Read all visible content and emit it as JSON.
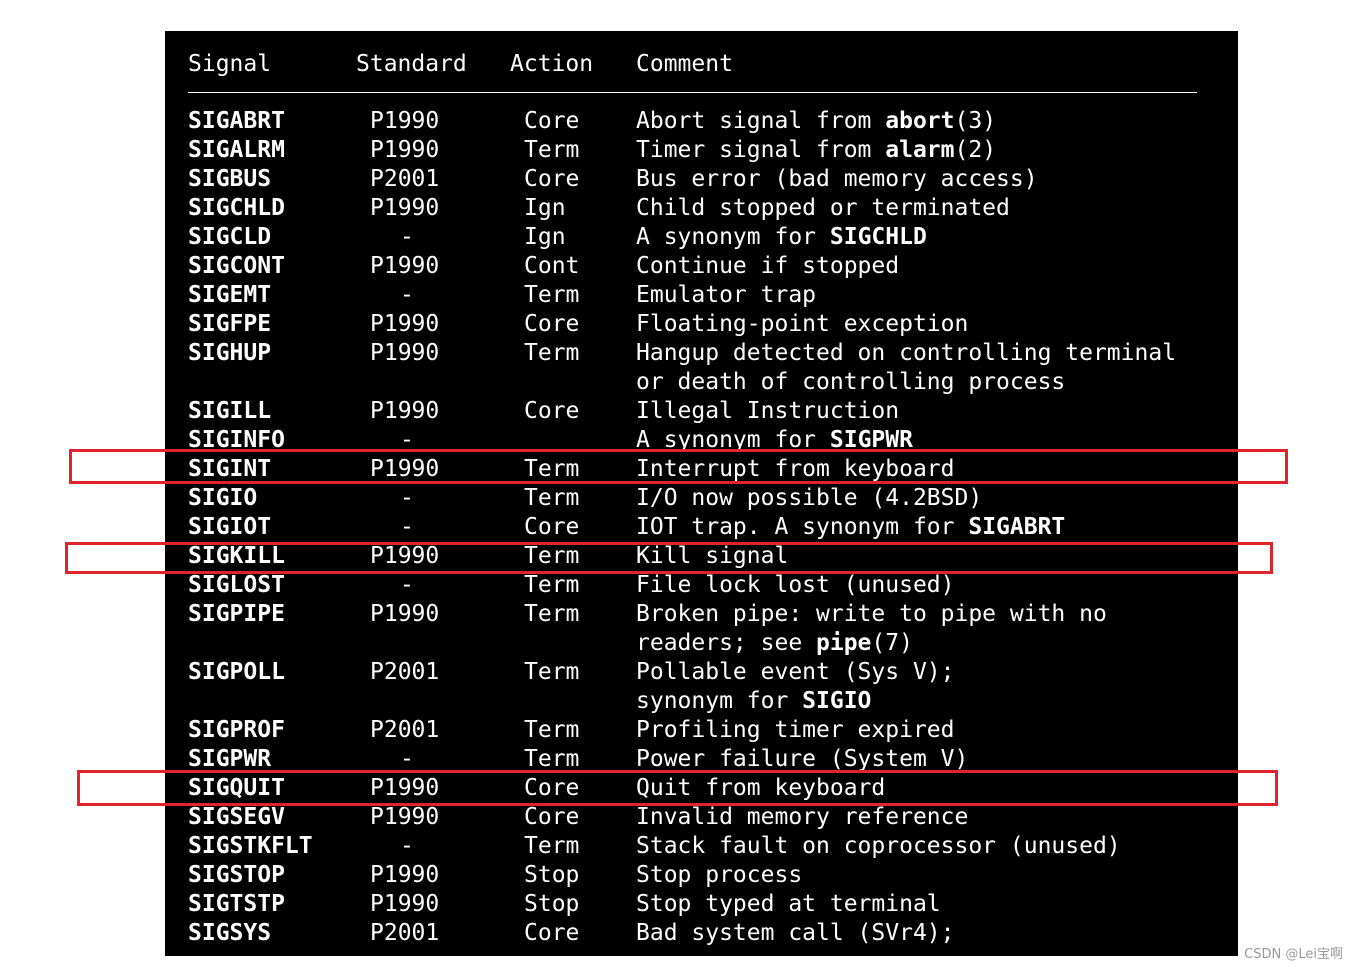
{
  "header": {
    "signal": "Signal",
    "standard": "Standard",
    "action": "Action",
    "comment": "Comment"
  },
  "rows": [
    {
      "signal": "SIGABRT",
      "standard": "P1990",
      "action": "Core",
      "comment": [
        {
          "t": "Abort signal from "
        },
        {
          "t": "abort",
          "b": true
        },
        {
          "t": "(3)"
        }
      ]
    },
    {
      "signal": "SIGALRM",
      "standard": "P1990",
      "action": "Term",
      "comment": [
        {
          "t": "Timer signal from "
        },
        {
          "t": "alarm",
          "b": true
        },
        {
          "t": "(2)"
        }
      ]
    },
    {
      "signal": "SIGBUS",
      "standard": "P2001",
      "action": "Core",
      "comment": [
        {
          "t": "Bus error (bad memory access)"
        }
      ]
    },
    {
      "signal": "SIGCHLD",
      "standard": "P1990",
      "action": "Ign",
      "comment": [
        {
          "t": "Child stopped or terminated"
        }
      ]
    },
    {
      "signal": "SIGCLD",
      "standard": "-",
      "action": "Ign",
      "comment": [
        {
          "t": "A synonym for "
        },
        {
          "t": "SIGCHLD",
          "b": true
        }
      ]
    },
    {
      "signal": "SIGCONT",
      "standard": "P1990",
      "action": "Cont",
      "comment": [
        {
          "t": "Continue if stopped"
        }
      ]
    },
    {
      "signal": "SIGEMT",
      "standard": "-",
      "action": "Term",
      "comment": [
        {
          "t": "Emulator trap"
        }
      ]
    },
    {
      "signal": "SIGFPE",
      "standard": "P1990",
      "action": "Core",
      "comment": [
        {
          "t": "Floating-point exception"
        }
      ]
    },
    {
      "signal": "SIGHUP",
      "standard": "P1990",
      "action": "Term",
      "comment": [
        {
          "t": "Hangup detected on controlling terminal"
        }
      ]
    },
    {
      "signal": "",
      "standard": "",
      "action": "",
      "comment": [
        {
          "t": "or death of controlling process"
        }
      ]
    },
    {
      "signal": "SIGILL",
      "standard": "P1990",
      "action": "Core",
      "comment": [
        {
          "t": "Illegal Instruction"
        }
      ]
    },
    {
      "signal": "SIGINFO",
      "standard": "-",
      "action": "",
      "comment": [
        {
          "t": "A synonym for "
        },
        {
          "t": "SIGPWR",
          "b": true
        }
      ]
    },
    {
      "signal": "SIGINT",
      "standard": "P1990",
      "action": "Term",
      "comment": [
        {
          "t": "Interrupt from keyboard"
        }
      ]
    },
    {
      "signal": "SIGIO",
      "standard": "-",
      "action": "Term",
      "comment": [
        {
          "t": "I/O now possible (4.2BSD)"
        }
      ]
    },
    {
      "signal": "SIGIOT",
      "standard": "-",
      "action": "Core",
      "comment": [
        {
          "t": "IOT trap. A synonym for "
        },
        {
          "t": "SIGABRT",
          "b": true
        }
      ]
    },
    {
      "signal": "SIGKILL",
      "standard": "P1990",
      "action": "Term",
      "comment": [
        {
          "t": "Kill signal"
        }
      ]
    },
    {
      "signal": "SIGLOST",
      "standard": "-",
      "action": "Term",
      "comment": [
        {
          "t": "File lock lost (unused)"
        }
      ]
    },
    {
      "signal": "SIGPIPE",
      "standard": "P1990",
      "action": "Term",
      "comment": [
        {
          "t": "Broken pipe: write to pipe with no"
        }
      ]
    },
    {
      "signal": "",
      "standard": "",
      "action": "",
      "comment": [
        {
          "t": "readers; see "
        },
        {
          "t": "pipe",
          "b": true
        },
        {
          "t": "(7)"
        }
      ]
    },
    {
      "signal": "SIGPOLL",
      "standard": "P2001",
      "action": "Term",
      "comment": [
        {
          "t": "Pollable event (Sys V);"
        }
      ]
    },
    {
      "signal": "",
      "standard": "",
      "action": "",
      "comment": [
        {
          "t": "synonym for "
        },
        {
          "t": "SIGIO",
          "b": true
        }
      ]
    },
    {
      "signal": "SIGPROF",
      "standard": "P2001",
      "action": "Term",
      "comment": [
        {
          "t": "Profiling timer expired"
        }
      ]
    },
    {
      "signal": "SIGPWR",
      "standard": "-",
      "action": "Term",
      "comment": [
        {
          "t": "Power failure (System V)"
        }
      ]
    },
    {
      "signal": "SIGQUIT",
      "standard": "P1990",
      "action": "Core",
      "comment": [
        {
          "t": "Quit from keyboard"
        }
      ]
    },
    {
      "signal": "SIGSEGV",
      "standard": "P1990",
      "action": "Core",
      "comment": [
        {
          "t": "Invalid memory reference"
        }
      ]
    },
    {
      "signal": "SIGSTKFLT",
      "standard": "-",
      "action": "Term",
      "comment": [
        {
          "t": "Stack fault on coprocessor (unused)"
        }
      ]
    },
    {
      "signal": "SIGSTOP",
      "standard": "P1990",
      "action": "Stop",
      "comment": [
        {
          "t": "Stop process"
        }
      ]
    },
    {
      "signal": "SIGTSTP",
      "standard": "P1990",
      "action": "Stop",
      "comment": [
        {
          "t": "Stop typed at terminal"
        }
      ]
    },
    {
      "signal": "SIGSYS",
      "standard": "P2001",
      "action": "Core",
      "comment": [
        {
          "t": "Bad system call (SVr4);"
        }
      ]
    }
  ],
  "highlights": [
    "SIGINT",
    "SIGKILL",
    "SIGQUIT"
  ],
  "highlight_color": "#e0242c",
  "watermark": "CSDN @Lei宝啊"
}
